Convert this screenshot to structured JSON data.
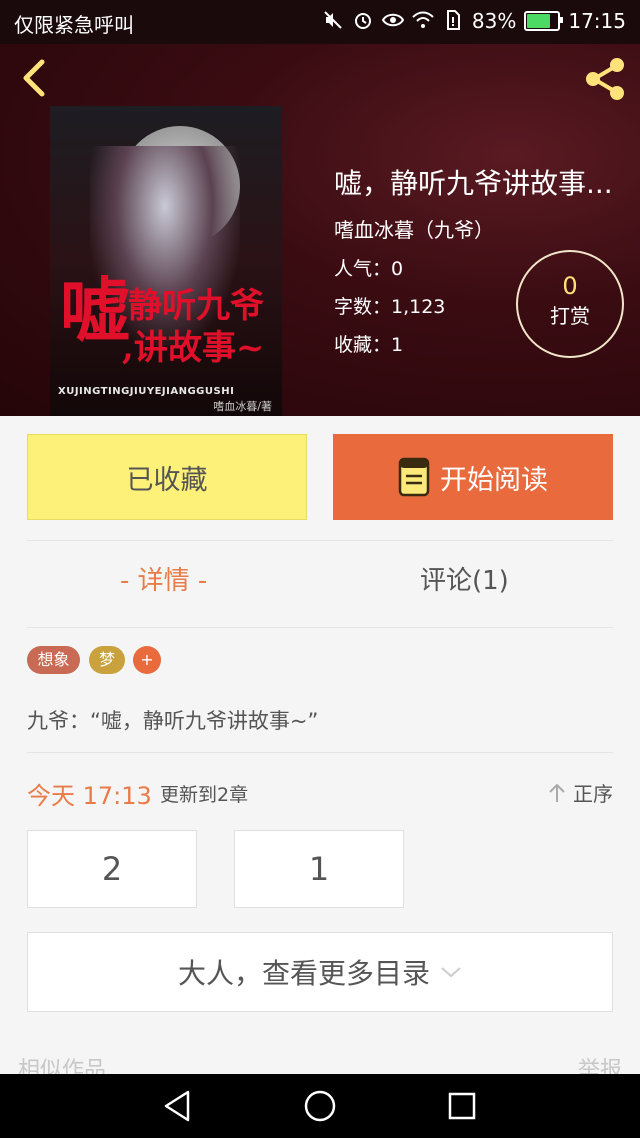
{
  "status_bar": {
    "left_text": "仅限紧急呼叫",
    "battery": "83%",
    "battery_level": 0.83,
    "time": "17:15",
    "icons": [
      "mute-icon",
      "alarm-icon",
      "eye-icon",
      "wifi-icon",
      "sim-icon",
      "battery-icon"
    ]
  },
  "header": {
    "back_icon": "chevron-left-icon",
    "share_icon": "share-icon",
    "accent_color": "#ffe27a"
  },
  "cover": {
    "title_big": "嘘",
    "title_line1": "静听九爷",
    "title_line2": ",讲故事~",
    "pinyin": "XUJINGTINGJIUYEJIANGGUSHI",
    "author_credit": "嗜血冰暮/著"
  },
  "book": {
    "title": "嘘，静听九爷讲故事...",
    "author": "嗜血冰暮（九爷）",
    "popularity": "人气：0",
    "word_count": "字数：1,123",
    "favorites": "收藏：1"
  },
  "reward": {
    "count": "0",
    "label": "打赏"
  },
  "actions": {
    "collected_label": "已收藏",
    "read_label": "开始阅读",
    "read_color": "#e96a3d",
    "collected_color": "#fdf17a"
  },
  "tabs": {
    "detail": "- 详情 -",
    "comments": "评论(1)"
  },
  "tags": [
    {
      "label": "想象",
      "color": "#c96a55"
    },
    {
      "label": "梦",
      "color": "#c9a23d"
    },
    {
      "label": "+",
      "color": "#e96a3d"
    }
  ],
  "summary": "九爷：“嘘，静听九爷讲故事~”",
  "update": {
    "time": "今天 17:13",
    "text": "更新到2章",
    "order_label": "正序"
  },
  "chapters": [
    "2",
    "1"
  ],
  "more_catalog": "大人，查看更多目录",
  "footer": {
    "similar": "相似作品",
    "report": "举报"
  },
  "nav": {
    "back": "back-triangle-icon",
    "home": "home-circle-icon",
    "recent": "recent-square-icon"
  }
}
